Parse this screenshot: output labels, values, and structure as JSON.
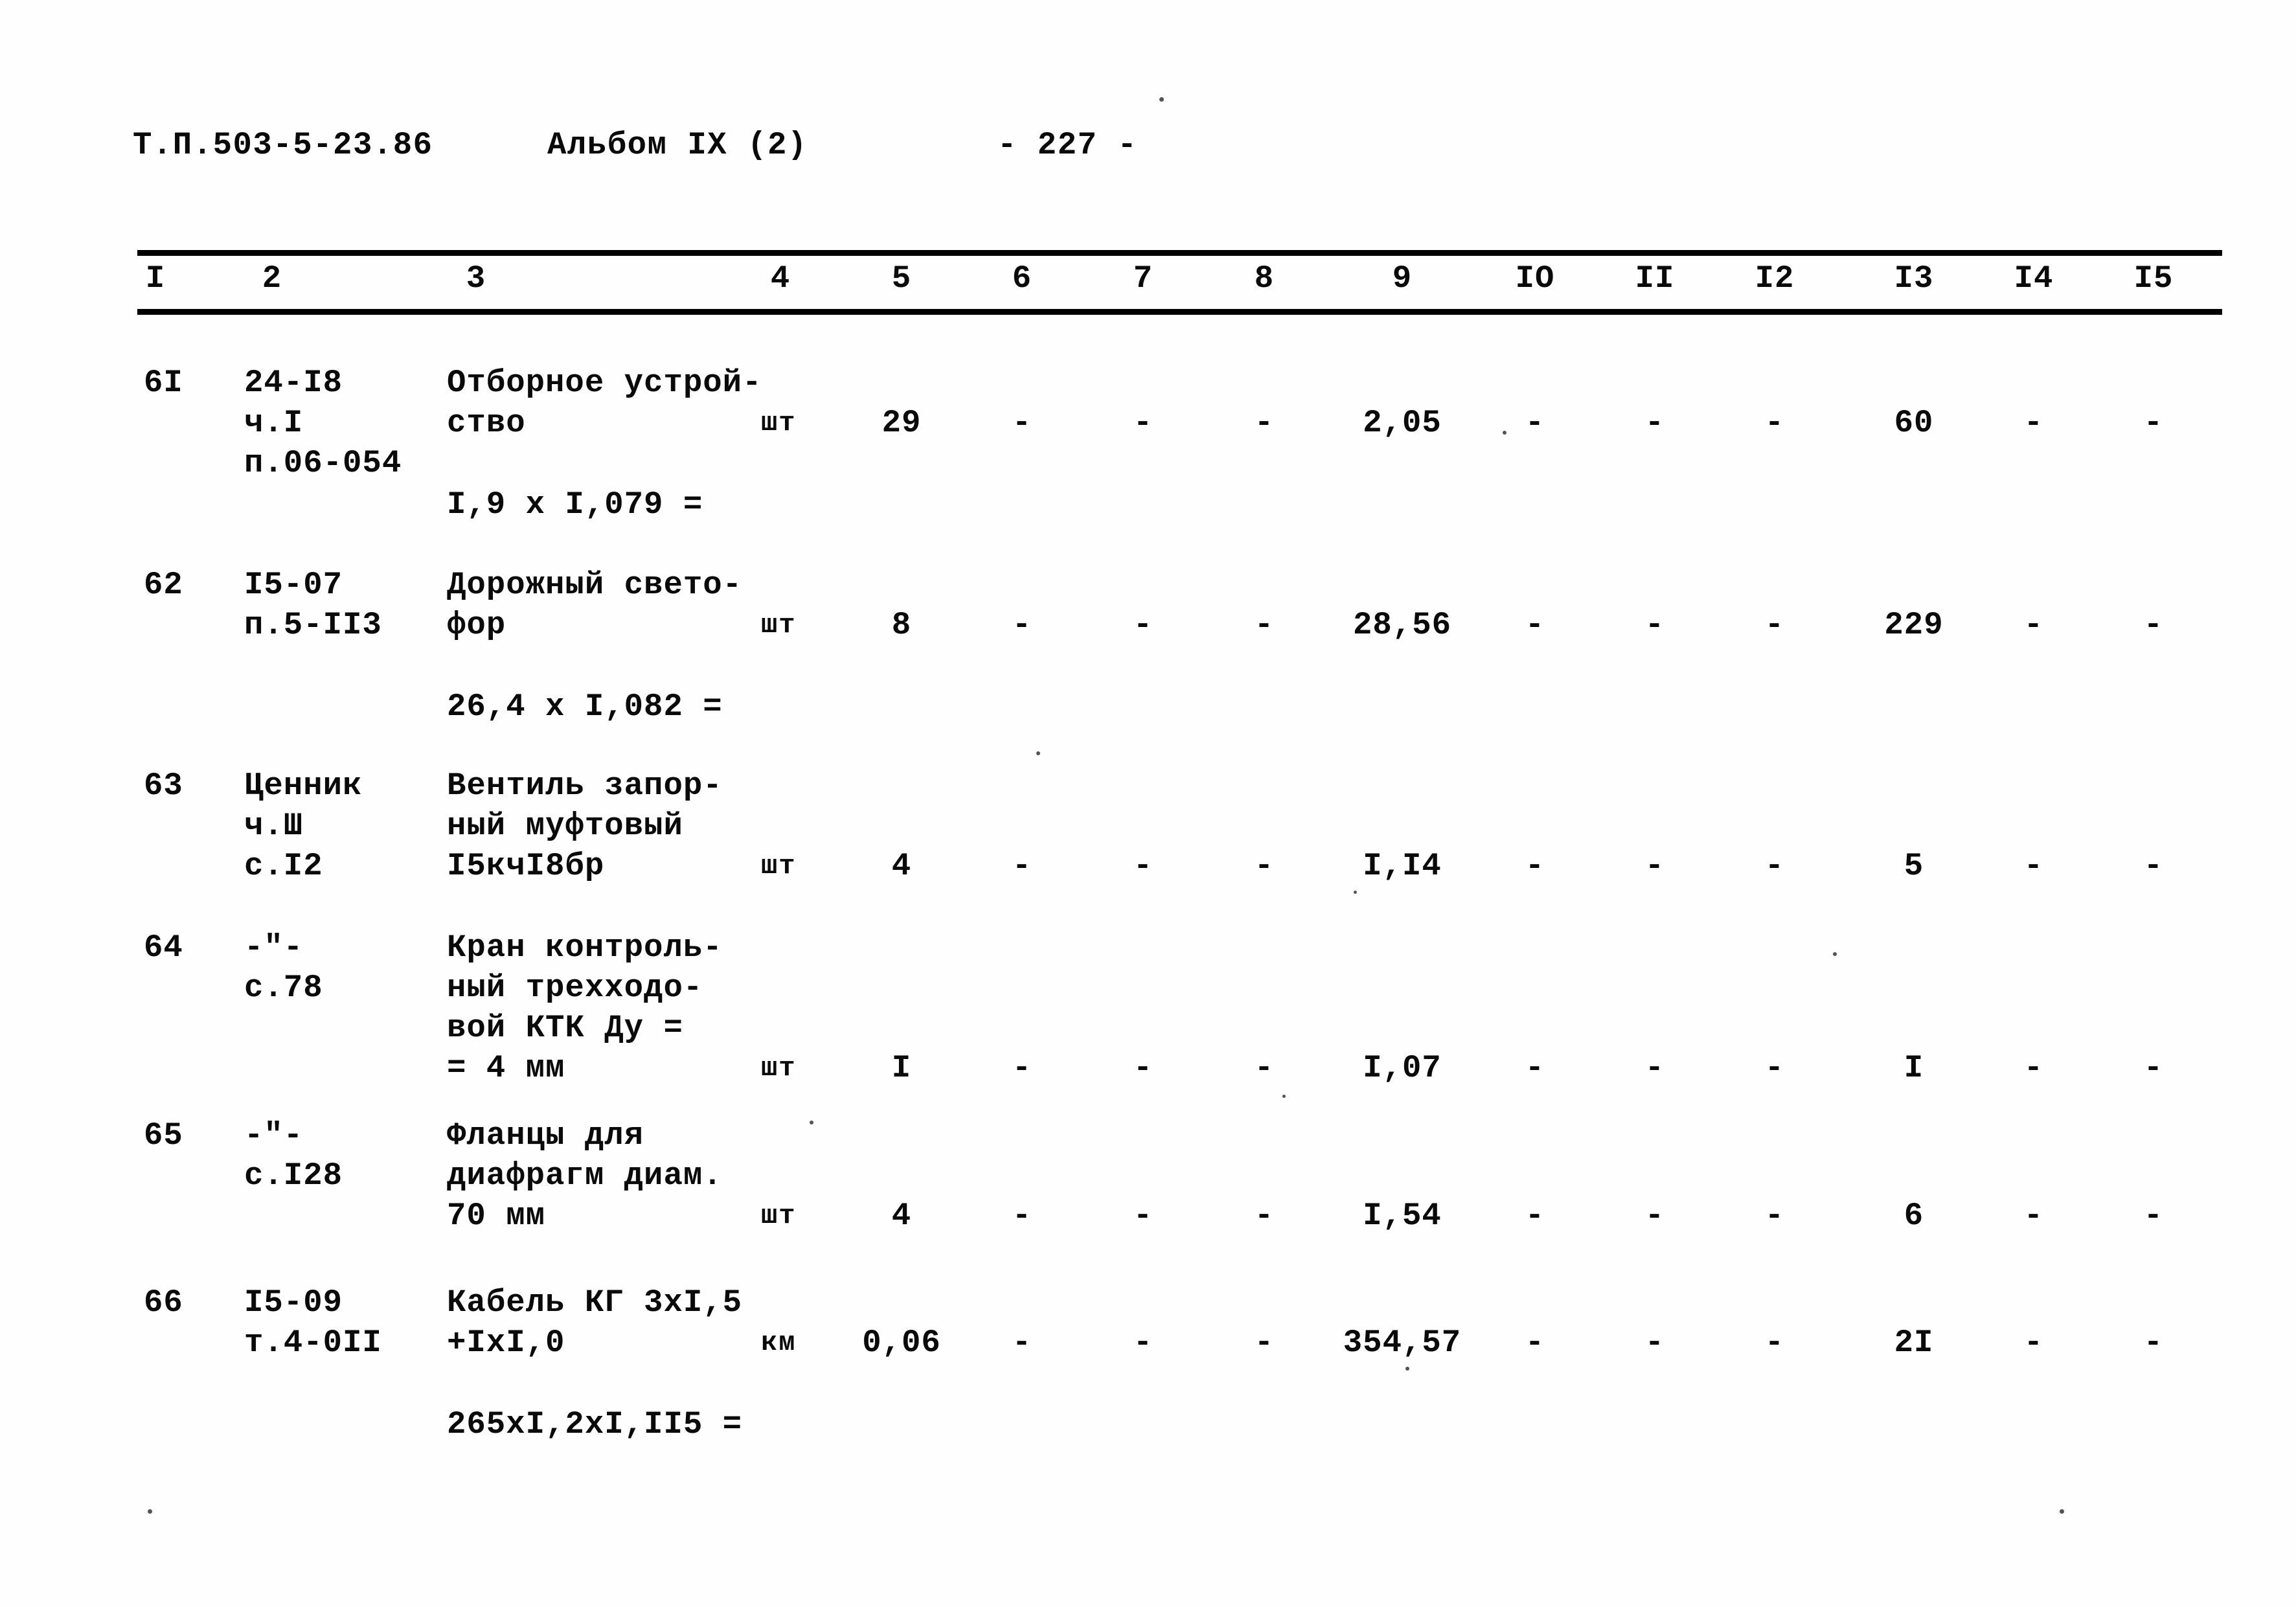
{
  "header": {
    "document_code": "Т.П.503-5-23.86",
    "album": "Альбом IX (2)",
    "page_number": "- 227 -"
  },
  "table": {
    "column_headers": [
      "I",
      "2",
      "3",
      "4",
      "5",
      "6",
      "7",
      "8",
      "9",
      "IO",
      "II",
      "I2",
      "I3",
      "I4",
      "I5"
    ],
    "dash": "-",
    "rows": [
      {
        "num": "6I",
        "code_lines": [
          "24-I8",
          "ч.I",
          "п.06-054"
        ],
        "name_lines": [
          "Отборное устрой-",
          "ство"
        ],
        "calc_line": "I,9 х I,079 =",
        "unit": "шт",
        "c5": "29",
        "c6": "-",
        "c7": "-",
        "c8": "-",
        "c9": "2,05",
        "c10": "-",
        "c11": "-",
        "c12": "-",
        "c13": "60",
        "c14": "-",
        "c15": "-"
      },
      {
        "num": "62",
        "code_lines": [
          "I5-07",
          "п.5-II3"
        ],
        "name_lines": [
          "Дорожный свето-",
          "фор"
        ],
        "calc_line": "26,4 х I,082 =",
        "unit": "шт",
        "c5": "8",
        "c6": "-",
        "c7": "-",
        "c8": "-",
        "c9": "28,56",
        "c10": "-",
        "c11": "-",
        "c12": "-",
        "c13": "229",
        "c14": "-",
        "c15": "-"
      },
      {
        "num": "63",
        "code_lines": [
          "Ценник",
          "ч.Ш",
          "с.I2"
        ],
        "name_lines": [
          "Вентиль запор-",
          "ный муфтовый",
          "I5кчI8бр"
        ],
        "calc_line": "",
        "unit": "шт",
        "c5": "4",
        "c6": "-",
        "c7": "-",
        "c8": "-",
        "c9": "I,I4",
        "c10": "-",
        "c11": "-",
        "c12": "-",
        "c13": "5",
        "c14": "-",
        "c15": "-"
      },
      {
        "num": "64",
        "code_lines": [
          "-\"-",
          "с.78"
        ],
        "name_lines": [
          "Кран контроль-",
          "ный трехходо-",
          "вой КТК Ду =",
          "= 4 мм"
        ],
        "calc_line": "",
        "unit": "шт",
        "c5": "I",
        "c6": "-",
        "c7": "-",
        "c8": "-",
        "c9": "I,07",
        "c10": "-",
        "c11": "-",
        "c12": "-",
        "c13": "I",
        "c14": "-",
        "c15": "-"
      },
      {
        "num": "65",
        "code_lines": [
          "-\"-",
          "с.I28"
        ],
        "name_lines": [
          "Фланцы для",
          "диафрагм диам.",
          "70 мм"
        ],
        "calc_line": "",
        "unit": "шт",
        "c5": "4",
        "c6": "-",
        "c7": "-",
        "c8": "-",
        "c9": "I,54",
        "c10": "-",
        "c11": "-",
        "c12": "-",
        "c13": "6",
        "c14": "-",
        "c15": "-"
      },
      {
        "num": "66",
        "code_lines": [
          "I5-09",
          "т.4-0II"
        ],
        "name_lines": [
          "Кабель КГ 3хI,5",
          "+IхI,0"
        ],
        "calc_line": "265хI,2хI,II5 =",
        "unit": "км",
        "c5": "0,06",
        "c6": "-",
        "c7": "-",
        "c8": "-",
        "c9": "354,57",
        "c10": "-",
        "c11": "-",
        "c12": "-",
        "c13": "2I",
        "c14": "-",
        "c15": "-"
      }
    ]
  }
}
